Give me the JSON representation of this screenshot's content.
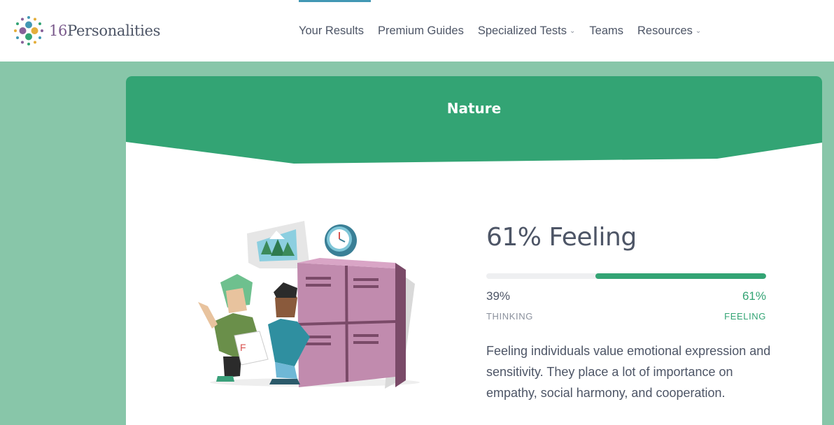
{
  "brand": {
    "name_num": "16",
    "name_text": "Personalities"
  },
  "nav": {
    "items": [
      {
        "label": "Your Results",
        "active": true,
        "dropdown": false
      },
      {
        "label": "Premium Guides",
        "active": false,
        "dropdown": false
      },
      {
        "label": "Specialized Tests",
        "active": false,
        "dropdown": true
      },
      {
        "label": "Teams",
        "active": false,
        "dropdown": false
      },
      {
        "label": "Resources",
        "active": false,
        "dropdown": true
      }
    ]
  },
  "card": {
    "banner_title": "Nature",
    "result_title": "61% Feeling",
    "left_pct": "39%",
    "right_pct": "61%",
    "left_label": "THINKING",
    "right_label": "FEELING",
    "feeling_fraction": 0.61,
    "description": "Feeling individuals value emotional expression and sensitivity. They place a lot of importance on empathy, social harmony, and cooperation."
  },
  "colors": {
    "accent_green": "#33a474",
    "page_bg": "#88c6a9",
    "nav_active": "#4298b4",
    "text": "#4d5566",
    "muted": "#8a909c"
  },
  "icons": [
    "logo-dots-icon",
    "chevron-down-icon",
    "illustration"
  ]
}
